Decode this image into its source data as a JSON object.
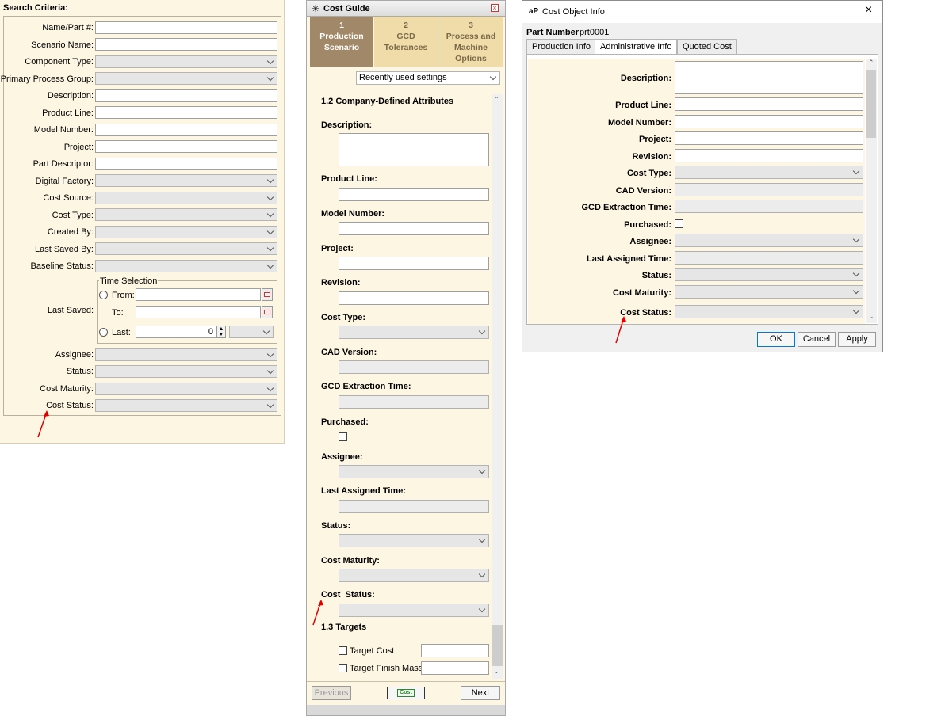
{
  "search_panel": {
    "title": "Search Criteria:",
    "labels": {
      "name_part": "Name/Part #:",
      "scenario_name": "Scenario Name:",
      "component_type": "Component Type:",
      "primary_process_group": "Primary Process Group:",
      "description": "Description:",
      "product_line": "Product Line:",
      "model_number": "Model Number:",
      "project": "Project:",
      "part_descriptor": "Part Descriptor:",
      "digital_factory": "Digital Factory:",
      "cost_source": "Cost Source:",
      "cost_type": "Cost Type:",
      "created_by": "Created By:",
      "last_saved_by": "Last Saved By:",
      "baseline_status": "Baseline Status:",
      "last_saved": "Last Saved:",
      "assignee": "Assignee:",
      "status": "Status:",
      "cost_maturity": "Cost Maturity:",
      "cost_status": "Cost Status:"
    },
    "time_selection": {
      "legend": "Time Selection",
      "from_label": "From:",
      "to_label": "To:",
      "last_label": "Last:",
      "last_value": "0"
    }
  },
  "cost_guide": {
    "title": "Cost Guide",
    "steps": [
      {
        "num": "1",
        "label_lines": [
          "Production",
          "Scenario"
        ]
      },
      {
        "num": "2",
        "label_lines": [
          "GCD",
          "Tolerances"
        ]
      },
      {
        "num": "3",
        "label_lines": [
          "Process and",
          "Machine",
          "Options"
        ]
      }
    ],
    "settings_dropdown": "Recently used settings",
    "section_attributes": "1.2 Company-Defined Attributes",
    "labels": {
      "description": "Description:",
      "product_line": "Product Line:",
      "model_number": "Model Number:",
      "project": "Project:",
      "revision": "Revision:",
      "cost_type": "Cost Type:",
      "cad_version": "CAD Version:",
      "gcd_extraction_time": "GCD Extraction Time:",
      "purchased": "Purchased:",
      "assignee": "Assignee:",
      "last_assigned_time": "Last Assigned Time:",
      "status": "Status:",
      "cost_maturity": "Cost Maturity:",
      "cost_status": "Cost  Status:"
    },
    "section_targets": "1.3 Targets",
    "targets": {
      "target_cost": "Target Cost",
      "target_finish_mass": "Target Finish Mass"
    },
    "buttons": {
      "previous": "Previous",
      "cost": "Cost",
      "next": "Next"
    }
  },
  "cost_object_info": {
    "title": "Cost Object Info",
    "logo_text": "aP",
    "part_number_label": "Part Number:",
    "part_number_value": "prt0001",
    "tabs": [
      "Production Info",
      "Administrative Info",
      "Quoted Cost"
    ],
    "active_tab_index": 1,
    "labels": {
      "description": "Description:",
      "product_line": "Product Line:",
      "model_number": "Model Number:",
      "project": "Project:",
      "revision": "Revision:",
      "cost_type": "Cost Type:",
      "cad_version": "CAD Version:",
      "gcd_extraction_time": "GCD Extraction Time:",
      "purchased": "Purchased:",
      "assignee": "Assignee:",
      "last_assigned_time": "Last Assigned Time:",
      "status": "Status:",
      "cost_maturity": "Cost Maturity:",
      "cost_status": "Cost Status:"
    },
    "buttons": {
      "ok": "OK",
      "cancel": "Cancel",
      "apply": "Apply"
    }
  },
  "colors": {
    "panel_bg": "#fdf6e3",
    "active_step": "#a08868",
    "inactive_step": "#f0dca8",
    "annotation_arrow": "#e00000"
  }
}
